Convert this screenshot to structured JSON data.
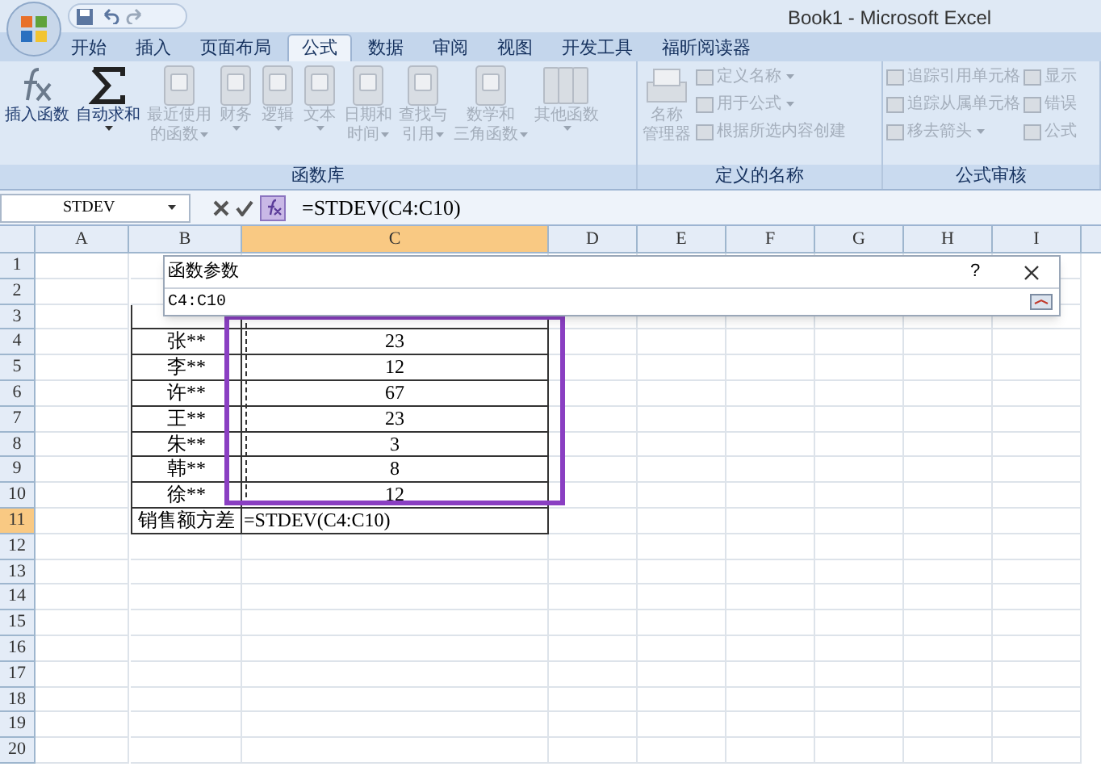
{
  "window": {
    "title": "Book1 - Microsoft Excel"
  },
  "tabs": [
    {
      "label": "开始",
      "selected": false
    },
    {
      "label": "插入",
      "selected": false
    },
    {
      "label": "页面布局",
      "selected": false
    },
    {
      "label": "公式",
      "selected": true
    },
    {
      "label": "数据",
      "selected": false
    },
    {
      "label": "审阅",
      "selected": false
    },
    {
      "label": "视图",
      "selected": false
    },
    {
      "label": "开发工具",
      "selected": false
    },
    {
      "label": "福昕阅读器",
      "selected": false
    }
  ],
  "ribbon": [
    {
      "label": "函数库",
      "items": [
        {
          "kind": "large",
          "lines": [
            "插入函数"
          ],
          "enabled": true,
          "menu": false
        },
        {
          "kind": "large",
          "lines": [
            "自动求和"
          ],
          "enabled": true,
          "menu": true
        },
        {
          "kind": "large",
          "lines": [
            "最近使用",
            "的函数"
          ],
          "enabled": false,
          "menu": true
        },
        {
          "kind": "large",
          "lines": [
            "财务"
          ],
          "enabled": false,
          "menu": true
        },
        {
          "kind": "large",
          "lines": [
            "逻辑"
          ],
          "enabled": false,
          "menu": true
        },
        {
          "kind": "large",
          "lines": [
            "文本"
          ],
          "enabled": false,
          "menu": true
        },
        {
          "kind": "large",
          "lines": [
            "日期和",
            "时间"
          ],
          "enabled": false,
          "menu": true
        },
        {
          "kind": "large",
          "lines": [
            "查找与",
            "引用"
          ],
          "enabled": false,
          "menu": true
        },
        {
          "kind": "large",
          "lines": [
            "数学和",
            "三角函数"
          ],
          "enabled": false,
          "menu": true
        },
        {
          "kind": "large",
          "lines": [
            "其他函数"
          ],
          "enabled": false,
          "menu": true
        }
      ]
    },
    {
      "label": "定义的名称",
      "items": [
        {
          "kind": "large",
          "lines": [
            "名称",
            "管理器"
          ],
          "enabled": false,
          "menu": false
        },
        {
          "kind": "smallstack",
          "entries": [
            {
              "label": "定义名称",
              "menu": true
            },
            {
              "label": "用于公式",
              "menu": true
            },
            {
              "label": "根据所选内容创建",
              "menu": false
            }
          ]
        }
      ]
    },
    {
      "label": "公式审核",
      "items": [
        {
          "kind": "smallstack",
          "entries": [
            {
              "label": "追踪引用单元格",
              "menu": false
            },
            {
              "label": "追踪从属单元格",
              "menu": false
            },
            {
              "label": "移去箭头",
              "menu": true
            }
          ]
        },
        {
          "kind": "smallstack",
          "entries": [
            {
              "label": "显示",
              "menu": false
            },
            {
              "label": "错误",
              "menu": false
            },
            {
              "label": "公式",
              "menu": false
            }
          ]
        }
      ]
    }
  ],
  "formula_bar": {
    "name_box": "STDEV",
    "formula": "=STDEV(C4:C10)"
  },
  "columns": [
    {
      "label": "A",
      "selected": false
    },
    {
      "label": "B",
      "selected": false
    },
    {
      "label": "C",
      "selected": true
    },
    {
      "label": "D",
      "selected": false
    },
    {
      "label": "E",
      "selected": false
    },
    {
      "label": "F",
      "selected": false
    },
    {
      "label": "G",
      "selected": false
    },
    {
      "label": "H",
      "selected": false
    },
    {
      "label": "I",
      "selected": false
    }
  ],
  "rows": [
    {
      "label": "1",
      "selected": false,
      "cells": []
    },
    {
      "label": "2",
      "selected": false,
      "cells": []
    },
    {
      "label": "3",
      "selected": false,
      "cells": []
    },
    {
      "label": "4",
      "selected": false,
      "cells": [
        "张**",
        "23"
      ]
    },
    {
      "label": "5",
      "selected": false,
      "cells": [
        "李**",
        "12"
      ]
    },
    {
      "label": "6",
      "selected": false,
      "cells": [
        "许**",
        "67"
      ]
    },
    {
      "label": "7",
      "selected": false,
      "cells": [
        "王**",
        "23"
      ]
    },
    {
      "label": "8",
      "selected": false,
      "cells": [
        "朱**",
        "3"
      ]
    },
    {
      "label": "9",
      "selected": false,
      "cells": [
        "韩**",
        "8"
      ]
    },
    {
      "label": "10",
      "selected": false,
      "cells": [
        "徐**",
        "12"
      ]
    },
    {
      "label": "11",
      "selected": true,
      "cells": [
        "销售额方差",
        "=STDEV(C4:C10)"
      ]
    },
    {
      "label": "12",
      "selected": false,
      "cells": []
    },
    {
      "label": "13",
      "selected": false,
      "cells": []
    },
    {
      "label": "14",
      "selected": false,
      "cells": []
    },
    {
      "label": "15",
      "selected": false,
      "cells": []
    },
    {
      "label": "16",
      "selected": false,
      "cells": []
    },
    {
      "label": "17",
      "selected": false,
      "cells": []
    },
    {
      "label": "18",
      "selected": false,
      "cells": []
    },
    {
      "label": "19",
      "selected": false,
      "cells": []
    },
    {
      "label": "20",
      "selected": false,
      "cells": []
    }
  ],
  "dialog": {
    "title": "函数参数",
    "help": "?",
    "value": "C4:C10"
  }
}
